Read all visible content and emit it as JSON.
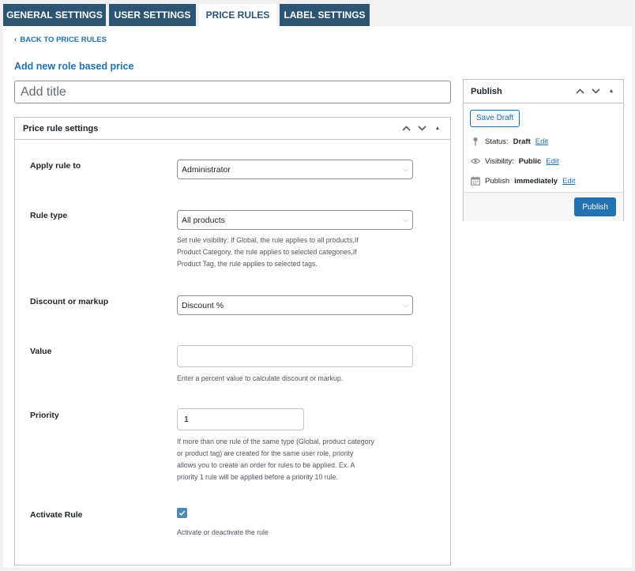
{
  "tabs": [
    {
      "label": "GENERAL SETTINGS",
      "active": false
    },
    {
      "label": "USER SETTINGS",
      "active": false
    },
    {
      "label": "PRICE RULES",
      "active": true
    },
    {
      "label": "LABEL SETTINGS",
      "active": false
    }
  ],
  "back_link": "BACK TO PRICE RULES",
  "page_title": "Add new role based price",
  "title_input": {
    "placeholder": "Add title",
    "value": ""
  },
  "settings_box": {
    "title": "Price rule settings",
    "apply_rule": {
      "label": "Apply rule to",
      "selected": "Administrator"
    },
    "rule_type": {
      "label": "Rule type",
      "selected": "All products",
      "help_lines": [
        "Set rule visibility: If Global, the rule applies to all products,If",
        "Product Category, the rule applies to selected categories,If",
        "Product Tag, the rule applies to selected tags."
      ]
    },
    "discount": {
      "label": "Discount or markup",
      "selected": "Discount %"
    },
    "value": {
      "label": "Value",
      "current": "",
      "help": "Enter a percent value to calculate discount or markup."
    },
    "priority": {
      "label": "Priority",
      "current": "1",
      "help_lines": [
        "If more than one rule of the same type (Global, product category",
        "or product tag) are created for the same user role, priority",
        "allows you to create an order for rules to be applied. Ex. A",
        "priority 1 rule will be applied before a priority 10 rule."
      ]
    },
    "activate": {
      "label": "Activate Rule",
      "checked": true,
      "help": "Activate or deactivate the rule"
    }
  },
  "publish_box": {
    "title": "Publish",
    "save_draft": "Save Draft",
    "status": {
      "prefix": "Status:",
      "value": "Draft",
      "edit": "Edit"
    },
    "visibility": {
      "prefix": "Visibility:",
      "value": "Public",
      "edit": "Edit"
    },
    "publish_time": {
      "prefix": "Publish",
      "value": "immediately",
      "edit": "Edit"
    },
    "publish_button": "Publish"
  },
  "colors": {
    "tab_bg": "#2c5473",
    "link": "#2271b1",
    "primary_button": "#2271b1",
    "checkbox": "#4a8ab8"
  }
}
